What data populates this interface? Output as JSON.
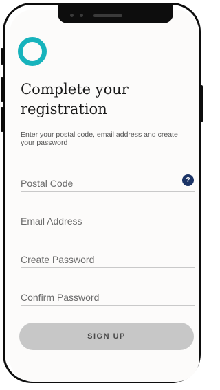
{
  "brand": {
    "logo_icon": "teal-ring-logo-icon",
    "accent_color": "#17b3bc"
  },
  "page": {
    "title": "Complete your registration",
    "subtitle": "Enter your postal code, email address and create your password"
  },
  "form": {
    "fields": [
      {
        "label": "Postal Code",
        "help_icon": "question-mark-icon"
      },
      {
        "label": "Email Address"
      },
      {
        "label": "Create Password"
      },
      {
        "label": "Confirm Password"
      }
    ],
    "submit_label": "SIGN UP"
  },
  "colors": {
    "help_icon_bg": "#1c3466",
    "button_bg": "#c7c7c7",
    "screen_bg": "#fcfbfa"
  }
}
